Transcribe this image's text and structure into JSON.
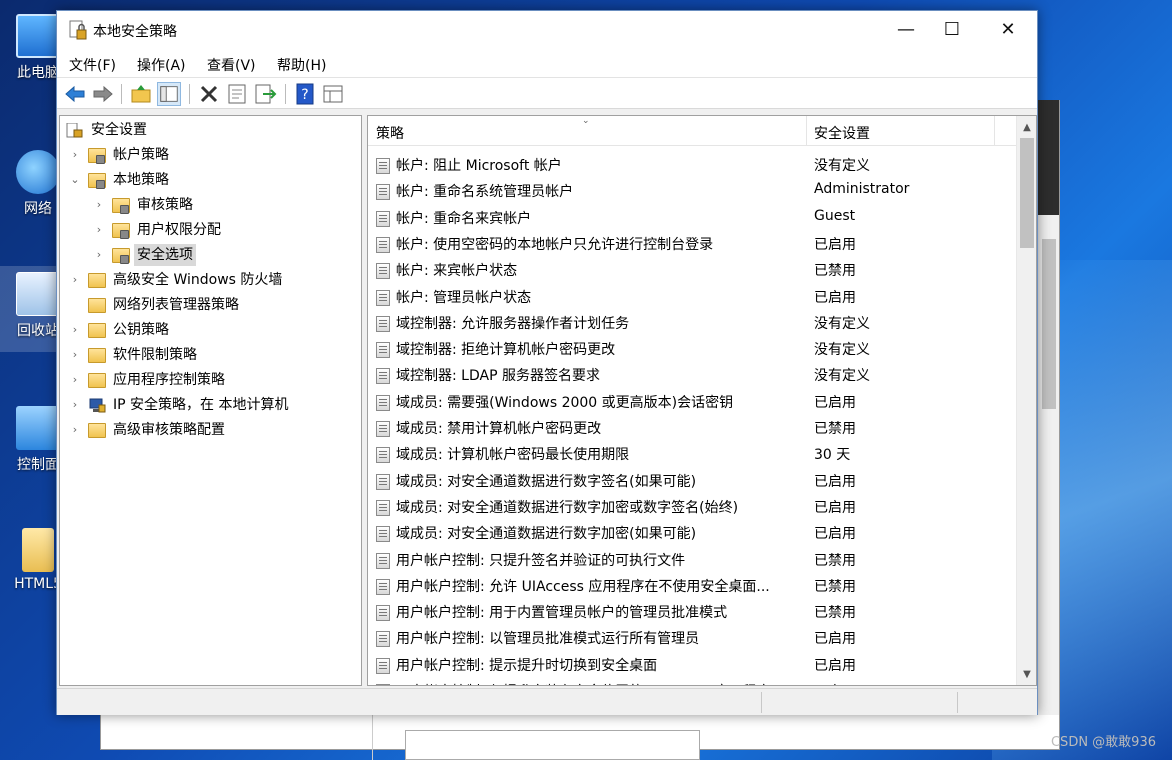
{
  "desktop": {
    "icons": [
      {
        "label": "此电脑"
      },
      {
        "label": "网络"
      },
      {
        "label": "回收站"
      },
      {
        "label": "控制面"
      },
      {
        "label": "HTML5"
      }
    ],
    "watermark": "CSDN @敢敢936"
  },
  "window": {
    "title": "本地安全策略",
    "controls": {
      "minimize": "—",
      "maximize": "☐",
      "close": "✕"
    }
  },
  "menu": [
    "文件(F)",
    "操作(A)",
    "查看(V)",
    "帮助(H)"
  ],
  "toolbar": {
    "icons": [
      "back-icon",
      "forward-icon",
      "up-folder-icon",
      "show-hide-tree-icon",
      "delete-icon",
      "properties-icon",
      "export-list-icon",
      "help-icon",
      "view-icon"
    ]
  },
  "tree": {
    "root": "安全设置",
    "items": [
      {
        "label": "帐户策略",
        "chevron": "›"
      },
      {
        "label": "本地策略",
        "chevron": "⌄"
      },
      {
        "label": "审核策略",
        "chevron": "›"
      },
      {
        "label": "用户权限分配",
        "chevron": "›"
      },
      {
        "label": "安全选项",
        "chevron": "›"
      },
      {
        "label": "高级安全 Windows 防火墙",
        "chevron": "›"
      },
      {
        "label": "网络列表管理器策略",
        "chevron": ""
      },
      {
        "label": "公钥策略",
        "chevron": "›"
      },
      {
        "label": "软件限制策略",
        "chevron": "›"
      },
      {
        "label": "应用程序控制策略",
        "chevron": "›"
      },
      {
        "label": "IP 安全策略，在 本地计算机",
        "chevron": "›"
      },
      {
        "label": "高级审核策略配置",
        "chevron": "›"
      }
    ]
  },
  "list": {
    "columns": {
      "policy": "策略",
      "setting": "安全设置"
    },
    "rows": [
      {
        "policy": "帐户: 阻止 Microsoft 帐户",
        "setting": "没有定义"
      },
      {
        "policy": "帐户: 重命名系统管理员帐户",
        "setting": "Administrator"
      },
      {
        "policy": "帐户: 重命名来宾帐户",
        "setting": "Guest"
      },
      {
        "policy": "帐户: 使用空密码的本地帐户只允许进行控制台登录",
        "setting": "已启用"
      },
      {
        "policy": "帐户: 来宾帐户状态",
        "setting": "已禁用"
      },
      {
        "policy": "帐户: 管理员帐户状态",
        "setting": "已启用"
      },
      {
        "policy": "域控制器: 允许服务器操作者计划任务",
        "setting": "没有定义"
      },
      {
        "policy": "域控制器: 拒绝计算机帐户密码更改",
        "setting": "没有定义"
      },
      {
        "policy": "域控制器: LDAP 服务器签名要求",
        "setting": "没有定义"
      },
      {
        "policy": "域成员: 需要强(Windows 2000 或更高版本)会话密钥",
        "setting": "已启用"
      },
      {
        "policy": "域成员: 禁用计算机帐户密码更改",
        "setting": "已禁用"
      },
      {
        "policy": "域成员: 计算机帐户密码最长使用期限",
        "setting": "30 天"
      },
      {
        "policy": "域成员: 对安全通道数据进行数字签名(如果可能)",
        "setting": "已启用"
      },
      {
        "policy": "域成员: 对安全通道数据进行数字加密或数字签名(始终)",
        "setting": "已启用"
      },
      {
        "policy": "域成员: 对安全通道数据进行数字加密(如果可能)",
        "setting": "已启用"
      },
      {
        "policy": "用户帐户控制: 只提升签名并验证的可执行文件",
        "setting": "已禁用"
      },
      {
        "policy": "用户帐户控制: 允许 UIAccess 应用程序在不使用安全桌面...",
        "setting": "已禁用"
      },
      {
        "policy": "用户帐户控制: 用于内置管理员帐户的管理员批准模式",
        "setting": "已禁用"
      },
      {
        "policy": "用户帐户控制: 以管理员批准模式运行所有管理员",
        "setting": "已启用"
      },
      {
        "policy": "用户帐户控制: 提示提升时切换到安全桌面",
        "setting": "已启用"
      },
      {
        "policy": "用户帐户控制: 仅提升安装在安全位置的 UIAccess 应用程序",
        "setting": "已启用"
      }
    ]
  }
}
